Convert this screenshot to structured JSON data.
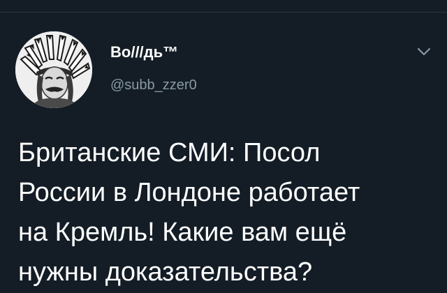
{
  "tweet": {
    "author": {
      "display_name": "Во///дь™",
      "handle": "@subb_zzer0",
      "avatar_icon": "avatar-portrait-headdress"
    },
    "menu_icon": "chevron-down-icon",
    "text_lines": [
      "Британские СМИ: Посол",
      "России в Лондоне работает",
      "на Кремль! Какие вам ещё",
      "нужны доказательства?"
    ]
  },
  "colors": {
    "background": "#141d26",
    "text": "#ffffff",
    "secondary_text": "#8899a6",
    "divider": "#2a3641"
  }
}
